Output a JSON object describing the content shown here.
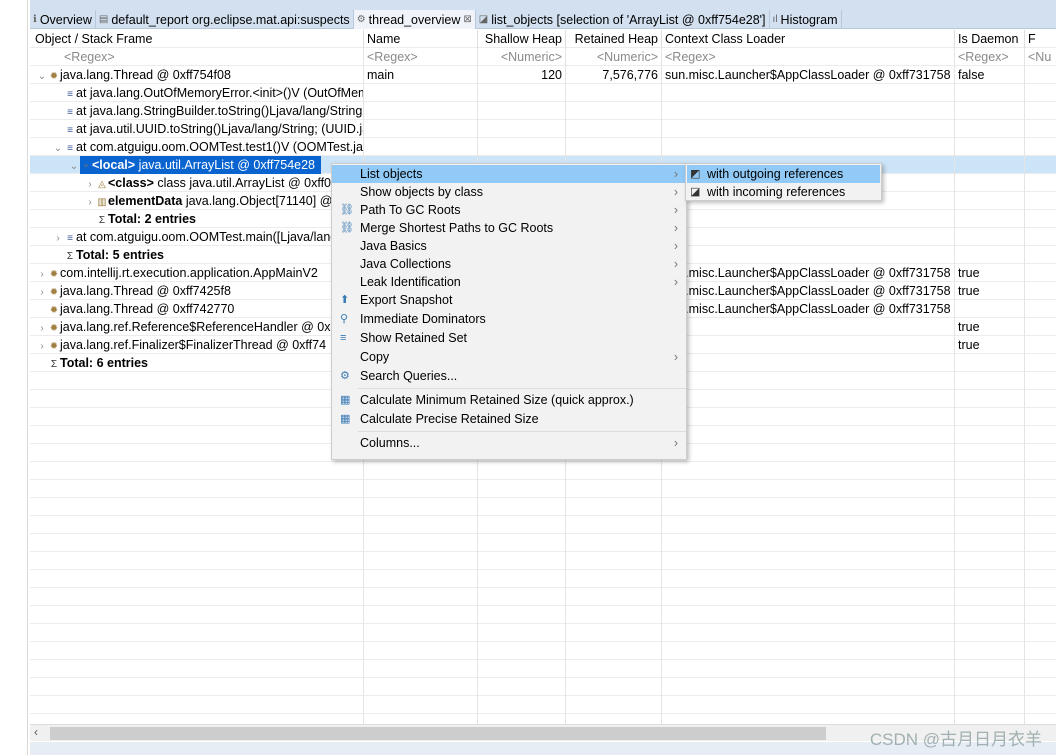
{
  "tabs": [
    {
      "icon": "info-icon",
      "label": "Overview"
    },
    {
      "icon": "report-icon",
      "label": "default_report  org.eclipse.mat.api:suspects"
    },
    {
      "icon": "thread-icon",
      "label": "thread_overview",
      "close": "⊠"
    },
    {
      "icon": "list-icon",
      "label": "list_objects  [selection of 'ArrayList @ 0xff754e28']"
    },
    {
      "icon": "histogram-icon",
      "label": "Histogram"
    }
  ],
  "columns": [
    "Object / Stack Frame",
    "Name",
    "Shallow Heap",
    "Retained Heap",
    "Context Class Loader",
    "Is Daemon",
    "F"
  ],
  "filters": [
    "<Regex>",
    "<Regex>",
    "<Numeric>",
    "<Numeric>",
    "<Regex>",
    "<Regex>",
    "<Nu"
  ],
  "rows": [
    {
      "indent": 0,
      "twisty": "⌄",
      "icon": "thread",
      "text": "java.lang.Thread @ 0xff754f08",
      "name": "main",
      "shallow": "120",
      "retained": "7,576,776",
      "loader": "sun.misc.Launcher$AppClassLoader @ 0xff731758",
      "daemon": "false"
    },
    {
      "indent": 1,
      "twisty": "",
      "icon": "frame",
      "text": "at java.lang.OutOfMemoryError.<init>()V (OutOfMemoryError.java)"
    },
    {
      "indent": 1,
      "twisty": "",
      "icon": "frame",
      "text": "at java.lang.StringBuilder.toString()Ljava/lang/String; (StringBuilder.java)"
    },
    {
      "indent": 1,
      "twisty": "",
      "icon": "frame",
      "text": "at java.util.UUID.toString()Ljava/lang/String; (UUID.java)"
    },
    {
      "indent": 1,
      "twisty": "⌄",
      "icon": "frame",
      "text": "at com.atguigu.oom.OOMTest.test1()V (OOMTest.java)"
    },
    {
      "indent": 2,
      "twisty": "⌄",
      "icon": "object",
      "bold": "<local>",
      "text": " java.util.ArrayList @ 0xff754e28",
      "selected": true
    },
    {
      "indent": 3,
      "twisty": "›",
      "icon": "class",
      "bold": "<class>",
      "text": " class java.util.ArrayList @ 0xff0"
    },
    {
      "indent": 3,
      "twisty": "›",
      "icon": "array",
      "bold": "elementData",
      "text": " java.lang.Object[71140] @"
    },
    {
      "indent": 3,
      "twisty": "",
      "icon": "sum",
      "bold": "Total: 2 entries",
      "text": ""
    },
    {
      "indent": 1,
      "twisty": "›",
      "icon": "frame",
      "text": "at com.atguigu.oom.OOMTest.main([Ljava/lang/String;)V"
    },
    {
      "indent": 1,
      "twisty": "",
      "icon": "sum",
      "bold": "Total: 5 entries",
      "text": ""
    },
    {
      "indent": 0,
      "twisty": "›",
      "icon": "thread",
      "text": "com.intellij.rt.execution.application.AppMainV2",
      "loader": "sun.misc.Launcher$AppClassLoader @ 0xff731758",
      "daemon": "true"
    },
    {
      "indent": 0,
      "twisty": "›",
      "icon": "thread",
      "text": "java.lang.Thread @ 0xff7425f8",
      "loader": "sun.misc.Launcher$AppClassLoader @ 0xff731758",
      "daemon": "true"
    },
    {
      "indent": 0,
      "twisty": "",
      "icon": "thread",
      "text": "java.lang.Thread @ 0xff742770",
      "loader": "sun.misc.Launcher$AppClassLoader @ 0xff731758"
    },
    {
      "indent": 0,
      "twisty": "›",
      "icon": "thread",
      "text": "java.lang.ref.Reference$ReferenceHandler @ 0x",
      "daemon": "true"
    },
    {
      "indent": 0,
      "twisty": "›",
      "icon": "thread",
      "text": "java.lang.ref.Finalizer$FinalizerThread @ 0xff74",
      "daemon": "true"
    },
    {
      "indent": 0,
      "twisty": "",
      "icon": "sum",
      "bold": "Total: 6 entries",
      "text": ""
    }
  ],
  "context_menu": [
    {
      "label": "List objects",
      "icon": "",
      "submenu": true,
      "highlight": true
    },
    {
      "label": "Show objects by class",
      "icon": "",
      "submenu": true
    },
    {
      "label": "Path To GC Roots",
      "icon": "path-icon",
      "submenu": true
    },
    {
      "label": "Merge Shortest Paths to GC Roots",
      "icon": "merge-paths-icon",
      "submenu": true
    },
    {
      "label": "Java Basics",
      "icon": "",
      "submenu": true
    },
    {
      "label": "Java Collections",
      "icon": "",
      "submenu": true
    },
    {
      "label": "Leak Identification",
      "icon": "",
      "submenu": true
    },
    {
      "label": "Export Snapshot",
      "icon": "export-icon"
    },
    {
      "label": "Immediate Dominators",
      "icon": "dominators-icon"
    },
    {
      "label": "Show Retained Set",
      "icon": "retained-set-icon"
    },
    {
      "label": "Copy",
      "icon": "",
      "submenu": true
    },
    {
      "label": "Search Queries...",
      "icon": "search-queries-icon",
      "sep_after": true
    },
    {
      "label": "Calculate Minimum Retained Size (quick approx.)",
      "icon": "calculator-icon"
    },
    {
      "label": "Calculate Precise Retained Size",
      "icon": "calculator-icon",
      "sep_after": true
    },
    {
      "label": "Columns...",
      "icon": "",
      "submenu": true
    }
  ],
  "submenu": [
    {
      "label": "with outgoing references",
      "icon": "outgoing-icon",
      "highlight": true
    },
    {
      "label": "with incoming references",
      "icon": "incoming-icon"
    }
  ],
  "watermark": "CSDN @古月日月衣羊",
  "colors": {
    "selection": "#0a64d0",
    "row_highlight": "#cce4f7",
    "menu_highlight": "#91c9f7",
    "tab_bar": "#d3e0ef"
  }
}
